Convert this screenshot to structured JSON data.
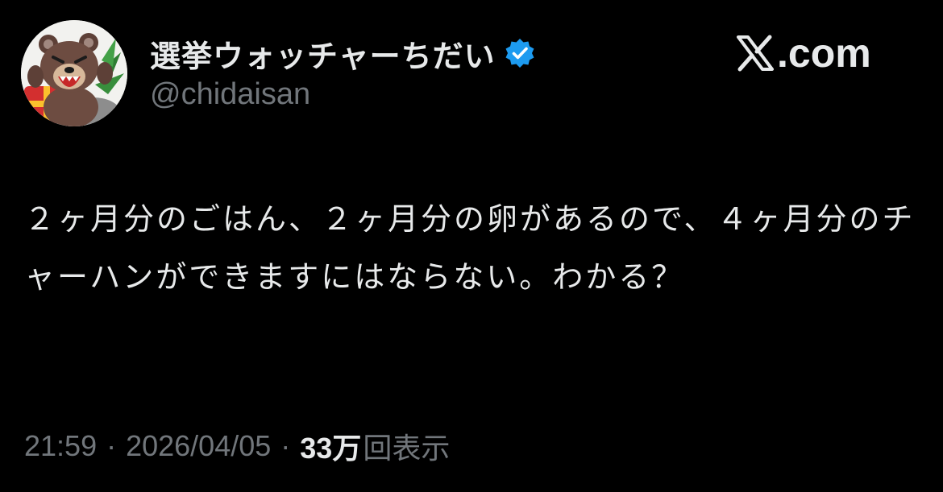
{
  "author": {
    "display_name": "選挙ウォッチャーちだい",
    "handle": "@chidaisan",
    "verified_icon": "verified-badge-icon",
    "verified_color": "#1d9bf0",
    "avatar_icon": "bear-avatar"
  },
  "brand": {
    "label": ".com",
    "icon": "x-logo-icon"
  },
  "tweet": {
    "text": "２ヶ月分のごはん、２ヶ月分の卵があるので、４ヶ月分のチャーハンができますにはならない。わかる？"
  },
  "meta": {
    "time": "21:59",
    "separator_1": "·",
    "date": "2026/04/05",
    "separator_2": "·",
    "views_count": "33万",
    "views_label": "回表示"
  },
  "colors": {
    "background": "#000000",
    "text_primary": "#e7e9ea",
    "text_secondary": "#71767b",
    "accent": "#1d9bf0"
  }
}
